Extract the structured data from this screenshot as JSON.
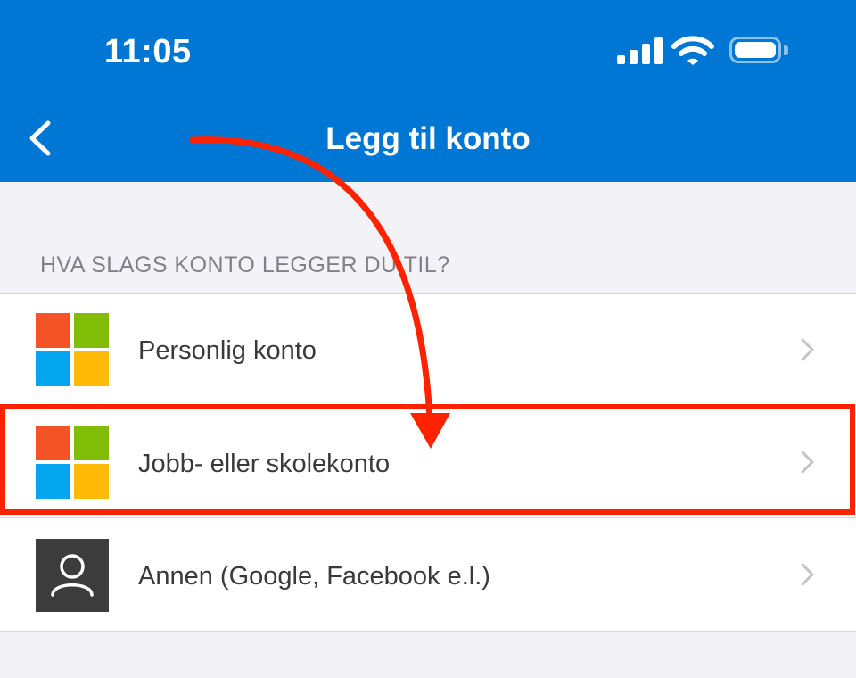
{
  "status_bar": {
    "time": "11:05"
  },
  "nav": {
    "title": "Legg til konto"
  },
  "section": {
    "header": "HVA SLAGS KONTO LEGGER DU TIL?"
  },
  "accounts": [
    {
      "label": "Personlig konto",
      "icon": "microsoft-logo-icon"
    },
    {
      "label": "Jobb- eller skolekonto",
      "icon": "microsoft-logo-icon"
    },
    {
      "label": "Annen (Google, Facebook e.l.)",
      "icon": "user-icon"
    }
  ],
  "colors": {
    "header": "#0077d4",
    "background": "#f2f2f7",
    "annotation": "#ff2200",
    "ms_red": "#f35325",
    "ms_green": "#81bc06",
    "ms_blue": "#05a6f0",
    "ms_yellow": "#ffba08"
  },
  "annotation": {
    "highlighted_item": "Jobb- eller skolekonto"
  }
}
